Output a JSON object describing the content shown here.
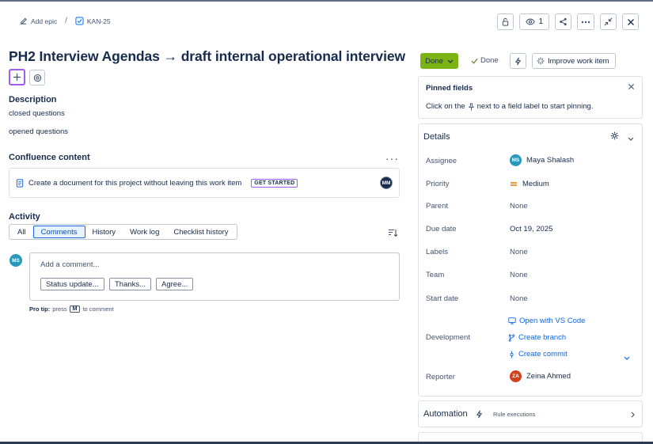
{
  "breadcrumb": {
    "add_epic": "Add epic",
    "separator": "/",
    "issue_key": "KAN-25"
  },
  "header_actions": {
    "watchers_count": "1"
  },
  "issue": {
    "title": "PH2 Interview Agendas → draft internal operational interview"
  },
  "description": {
    "heading": "Description",
    "lines": [
      "closed questions",
      "opened questions"
    ]
  },
  "confluence": {
    "heading": "Confluence content",
    "message": "Create a document for this project without leaving this work item",
    "cta": "GET STARTED",
    "avatar_initials": "MM"
  },
  "activity": {
    "heading": "Activity",
    "tabs": [
      "All",
      "Comments",
      "History",
      "Work log",
      "Checklist history"
    ],
    "active_tab": "Comments",
    "comment_placeholder": "Add a comment...",
    "quick_replies": [
      "Status update...",
      "Thanks...",
      "Agree..."
    ],
    "user_initials": "MS",
    "protip": {
      "label": "Pro tip:",
      "press": "press",
      "key": "M",
      "suffix": "to comment"
    }
  },
  "status": {
    "button_label": "Done",
    "resolution": "Done",
    "button_color": "#7cb314"
  },
  "improve": {
    "label": "Improve work item"
  },
  "pinned": {
    "title": "Pinned fields",
    "message_before": "Click on the",
    "message_after": "next to a field label to start pinning."
  },
  "details": {
    "title": "Details",
    "assignee": {
      "label": "Assignee",
      "value": "Maya Shalash",
      "initials": "MS",
      "color": "#2898bd"
    },
    "priority": {
      "label": "Priority",
      "value": "Medium",
      "color": "#e2740f"
    },
    "parent": {
      "label": "Parent",
      "value": "None"
    },
    "due_date": {
      "label": "Due date",
      "value": "Oct 19, 2025"
    },
    "labels": {
      "label": "Labels",
      "value": "None"
    },
    "team": {
      "label": "Team",
      "value": "None"
    },
    "start_date": {
      "label": "Start date",
      "value": "None"
    },
    "development": {
      "label": "Development",
      "links": [
        "Open with VS Code",
        "Create branch",
        "Create commit"
      ]
    },
    "reporter": {
      "label": "Reporter",
      "value": "Zeina Ahmed",
      "initials": "ZA",
      "color": "#d0421b"
    }
  },
  "automation": {
    "title": "Automation",
    "rule_label": "Rule executions"
  }
}
